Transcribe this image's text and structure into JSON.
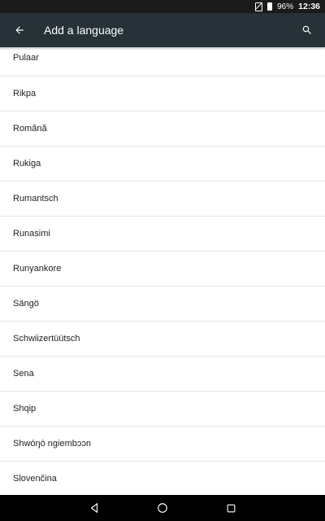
{
  "status_bar": {
    "battery_percent": "96%",
    "time": "12:36"
  },
  "app_bar": {
    "title": "Add a language",
    "back_icon": "arrow-back-icon",
    "search_icon": "search-icon"
  },
  "languages": [
    "Pulaar",
    "Rikpa",
    "Română",
    "Rukiga",
    "Rumantsch",
    "Runasimi",
    "Runyankore",
    "Sängö",
    "Schwiizertüütsch",
    "Sena",
    "Shqip",
    "Shwóŋò ngiembɔɔn",
    "Slovenčina"
  ],
  "nav_bar": {
    "back_icon": "nav-back-icon",
    "home_icon": "nav-home-icon",
    "recents_icon": "nav-recents-icon"
  },
  "colors": {
    "app_bar": "#263238",
    "status_bar": "#1b1b1b",
    "nav_bar": "#000000",
    "divider": "#e4e4e4"
  }
}
